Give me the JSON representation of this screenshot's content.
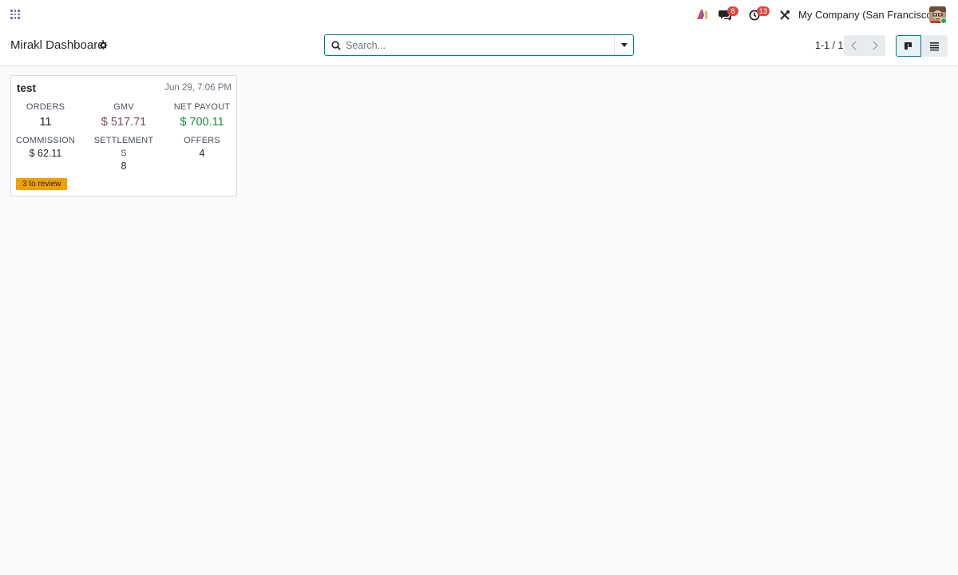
{
  "navbar": {
    "messages_badge": "8",
    "activities_badge": "13",
    "company": "My Company (San Francisco)",
    "icons": [
      "apps-icon",
      "ai-icon",
      "chat-icon",
      "clock-icon",
      "tools-icon",
      "avatar"
    ]
  },
  "control_panel": {
    "title": "Mirakl Dashboard",
    "search_placeholder": "Search...",
    "pager": "1-1 / 1",
    "active_view": "kanban",
    "accent_color": "#017e84"
  },
  "card": {
    "title": "test",
    "date": "Jun 29, 7:06 PM",
    "stats": [
      {
        "label": "ORDERS",
        "value": "11"
      },
      {
        "label": "GMV",
        "value": "$ 517.71",
        "color": "#714b67"
      },
      {
        "label": "NET PAYOUT",
        "value": "$ 700.11",
        "color": "#1e8e3e"
      },
      {
        "label": "COMMISSION",
        "value": "$ 62.11"
      },
      {
        "label": "SETTLEMENT\nS",
        "value": "8"
      },
      {
        "label": "OFFERS",
        "value": "4"
      }
    ],
    "review_badge": "3 to review",
    "review_badge_color": "#f0a000"
  }
}
